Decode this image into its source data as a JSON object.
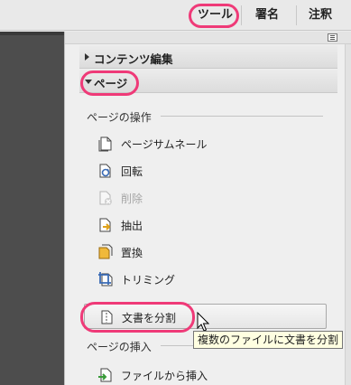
{
  "toolbar": {
    "tabs": [
      {
        "label": "ツール"
      },
      {
        "label": "署名"
      },
      {
        "label": "注釈"
      }
    ]
  },
  "panel": {
    "sections": [
      {
        "label": "コンテンツ編集",
        "expanded": false
      },
      {
        "label": "ページ",
        "expanded": true
      }
    ],
    "groups": {
      "page_operations": {
        "title": "ページの操作",
        "items": [
          {
            "label": "ページサムネール",
            "icon": "page-thumbnail-icon",
            "enabled": true
          },
          {
            "label": "回転",
            "icon": "rotate-icon",
            "enabled": true
          },
          {
            "label": "削除",
            "icon": "delete-page-icon",
            "enabled": false
          },
          {
            "label": "抽出",
            "icon": "extract-icon",
            "enabled": true
          },
          {
            "label": "置換",
            "icon": "replace-icon",
            "enabled": true
          },
          {
            "label": "トリミング",
            "icon": "crop-icon",
            "enabled": true
          },
          {
            "label": "文書を分割",
            "icon": "split-document-icon",
            "enabled": true,
            "selected": true
          }
        ]
      },
      "page_insert": {
        "title": "ページの挿入",
        "items": [
          {
            "label": "ファイルから挿入",
            "icon": "insert-from-file-icon",
            "enabled": true
          }
        ]
      }
    }
  },
  "tooltip": {
    "text": "複数のファイルに文書を分割"
  },
  "colors": {
    "highlight": "#ef3a78",
    "document_area": "#4d4d4d",
    "panel_bg": "#efefef",
    "tooltip_bg": "#ffffe1"
  }
}
